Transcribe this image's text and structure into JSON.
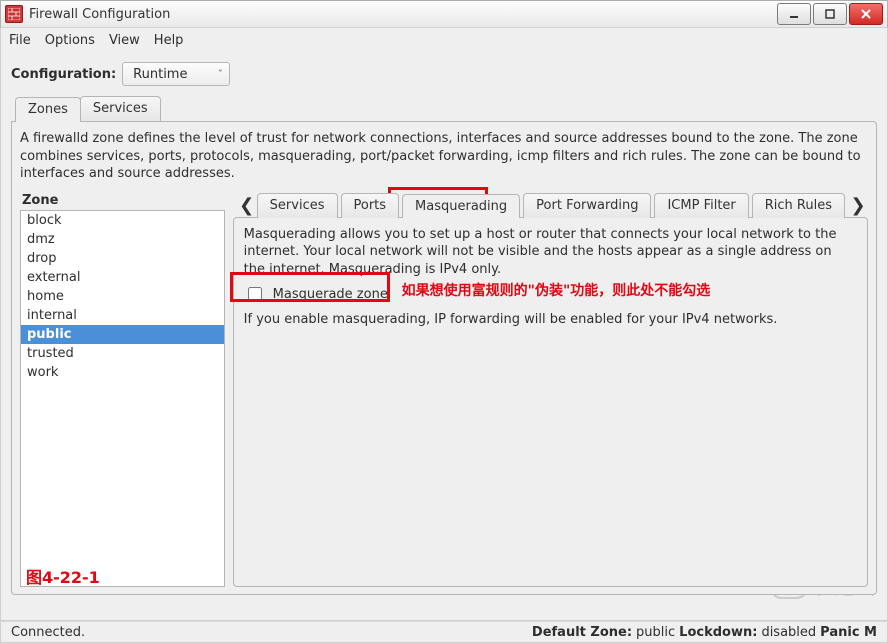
{
  "window": {
    "title": "Firewall Configuration"
  },
  "menu": {
    "file": "File",
    "options": "Options",
    "view": "View",
    "help": "Help"
  },
  "config": {
    "label": "Configuration:",
    "selected": "Runtime"
  },
  "outer_tabs": {
    "zones": "Zones",
    "services": "Services"
  },
  "zone_panel": {
    "description": "A firewalld zone defines the level of trust for network connections, interfaces and source addresses bound to the zone. The zone combines services, ports, protocols, masquerading, port/packet forwarding, icmp filters and rich rules. The zone can be bound to interfaces and source addresses.",
    "heading": "Zone",
    "items": [
      "block",
      "dmz",
      "drop",
      "external",
      "home",
      "internal",
      "public",
      "trusted",
      "work"
    ],
    "selected": "public"
  },
  "inner_tabs": {
    "services": "Services",
    "ports": "Ports",
    "masquerading": "Masquerading",
    "port_forwarding": "Port Forwarding",
    "icmp_filter": "ICMP Filter",
    "rich_rules": "Rich Rules"
  },
  "masq": {
    "description": "Masquerading allows you to set up a host or router that connects your local network to the internet. Your local network will not be visible and the hosts appear as a single address on the internet. Masquerading is IPv4 only.",
    "checkbox_label": "Masquerade zone",
    "checked": false,
    "enable_note": "If you enable masquerading, IP forwarding will be enabled for your IPv4 networks."
  },
  "annotations": {
    "rich_rule_note": "如果想使用富规则的\"伪装\"功能，则此处不能勾选",
    "figure_label": "图4-22-1"
  },
  "status": {
    "left": "Connected.",
    "default_zone_label": "Default Zone:",
    "default_zone_value": "public",
    "lockdown_label": "Lockdown:",
    "lockdown_value": "disabled",
    "panic_label": "Panic M"
  },
  "watermark": "亿速云"
}
